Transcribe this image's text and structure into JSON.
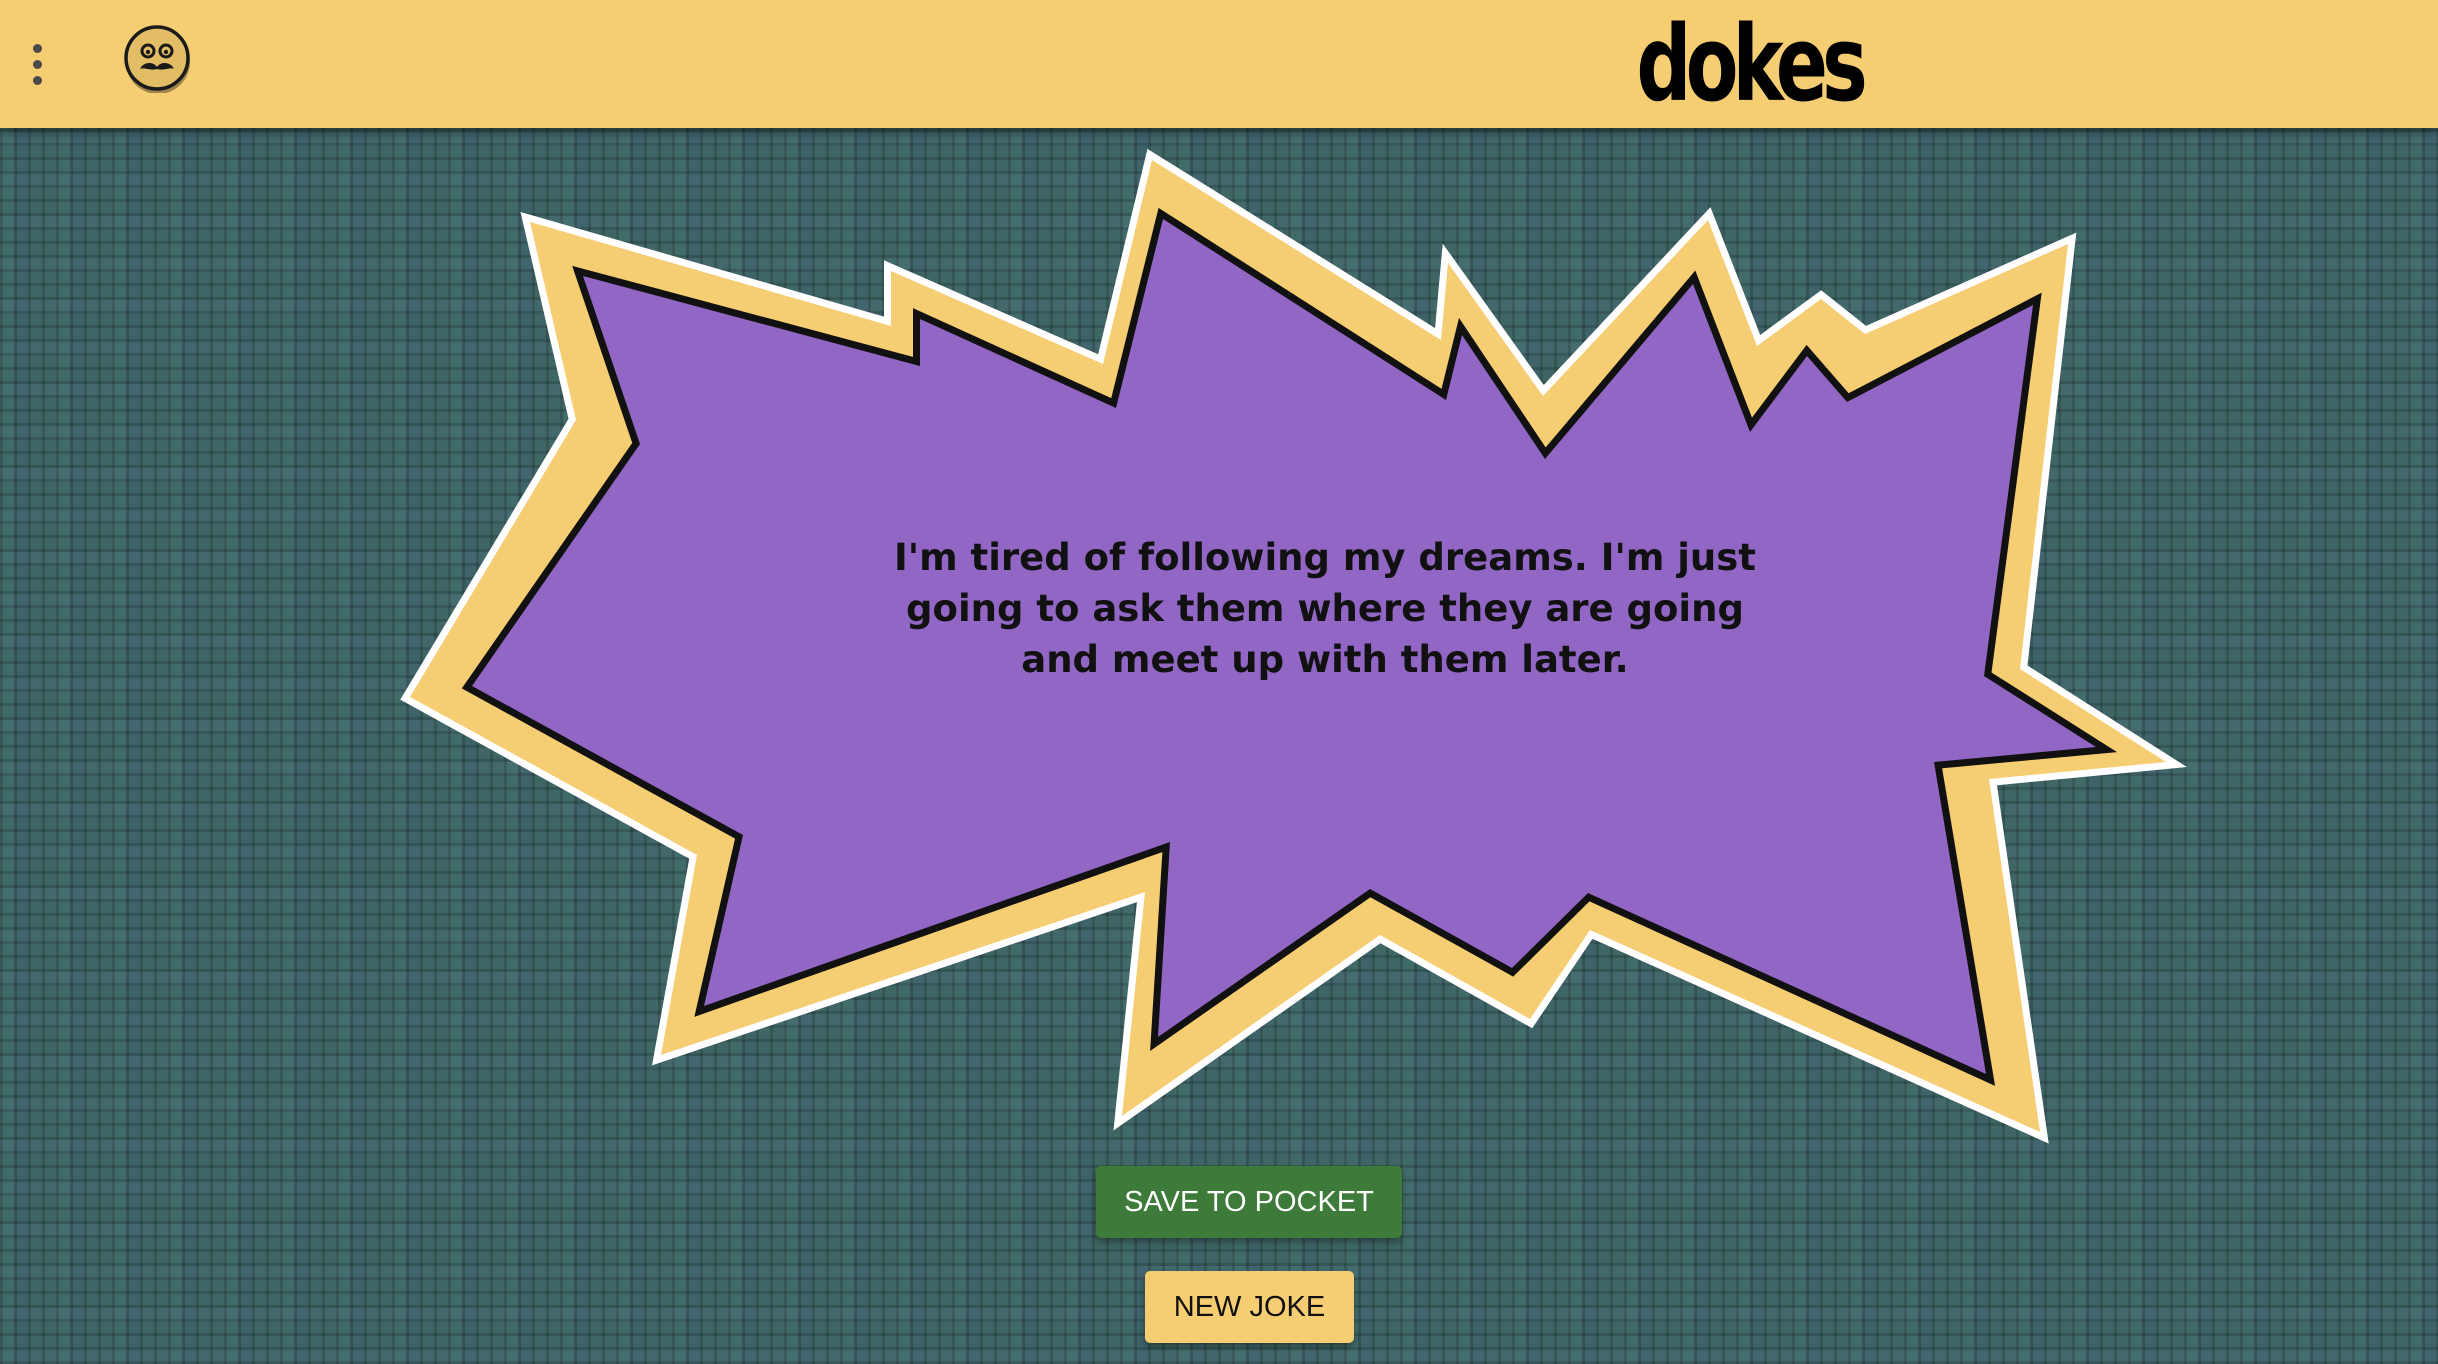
{
  "header": {
    "brand": "dokes",
    "menu_icon": "vertical-dots-icon",
    "logo_icon": "mustache-face-icon"
  },
  "main": {
    "joke_text": "I'm tired of following my dreams. I'm just going to ask them where they are going and meet up with them later.",
    "burst_fill_color": "#9166c4",
    "burst_outline_color": "#f5cd73"
  },
  "actions": {
    "save_label": "SAVE TO POCKET",
    "new_joke_label": "NEW JOKE"
  },
  "colors": {
    "header_bg": "#f5cd73",
    "save_button_bg": "#3e7a3a",
    "new_joke_button_bg": "#f5cd73",
    "page_bg": "#3f6468"
  }
}
